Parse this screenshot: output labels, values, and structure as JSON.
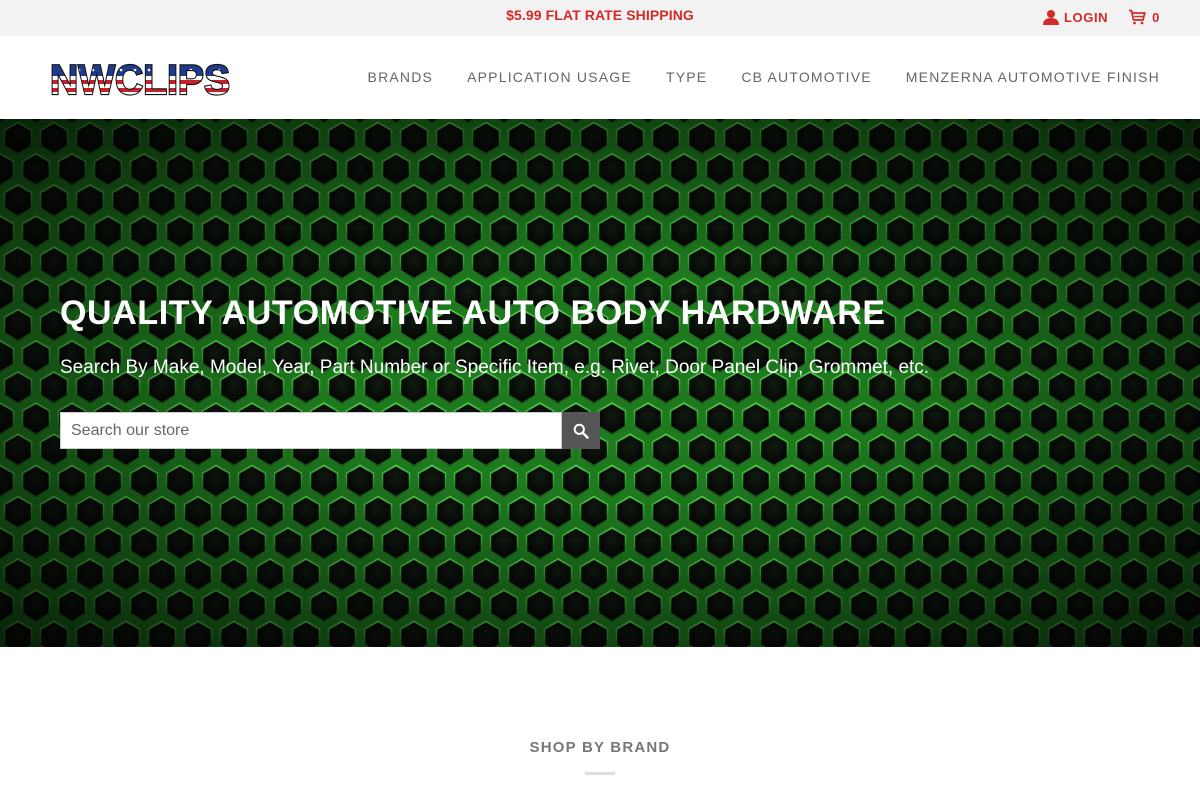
{
  "topbar": {
    "promo": "$5.99 FLAT RATE SHIPPING",
    "login_label": "LOGIN",
    "cart_count": "0",
    "login_icon": "user-icon",
    "cart_icon": "cart-icon"
  },
  "header": {
    "logo_text": "NWCLIPS",
    "nav": [
      {
        "label": "BRANDS"
      },
      {
        "label": "APPLICATION USAGE"
      },
      {
        "label": "TYPE"
      },
      {
        "label": "CB AUTOMOTIVE"
      },
      {
        "label": "MENZERNA AUTOMOTIVE FINISH"
      }
    ]
  },
  "hero": {
    "title": "QUALITY AUTOMOTIVE AUTO BODY HARDWARE",
    "subtitle": "Search By Make, Model, Year, Part Number or Specific Item, e.g. Rivet, Door Panel Clip, Grommet, etc.",
    "search_placeholder": "Search our store",
    "search_icon": "search-icon"
  },
  "section": {
    "title": "SHOP BY BRAND"
  },
  "colors": {
    "accent": "#d42a2a",
    "nav_text": "#666666",
    "hex_green": "#2f9a2f",
    "search_button": "#555555"
  }
}
